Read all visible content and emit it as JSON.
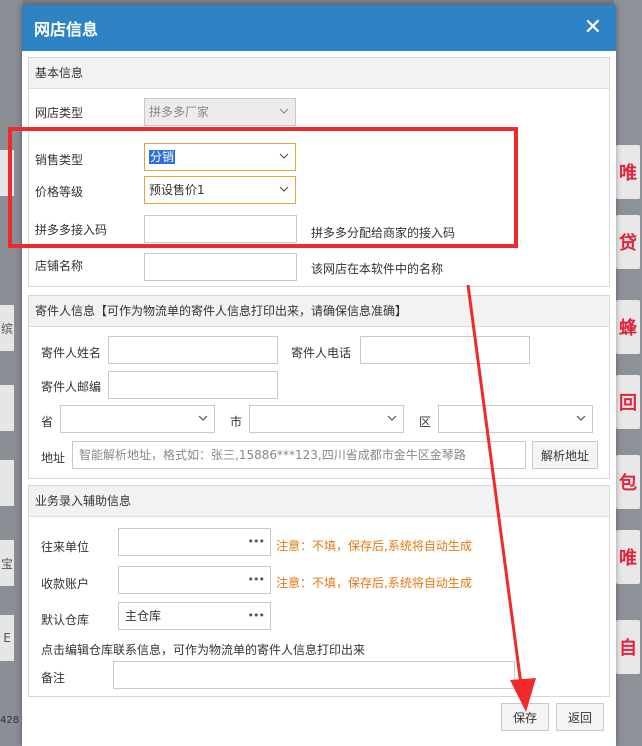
{
  "dialog": {
    "title": "网店信息",
    "close_glyph": "✕"
  },
  "basic": {
    "header": "基本信息",
    "shop_type_label": "网店类型",
    "shop_type_value": "拼多多厂家",
    "sales_type_label": "销售类型",
    "sales_type_value": "分销",
    "price_level_label": "价格等级",
    "price_level_value": "预设售价1",
    "access_code_label": "拼多多接入码",
    "access_code_hint": "拼多多分配给商家的接入码",
    "shop_name_label": "店铺名称",
    "shop_name_hint": "该网店在本软件中的名称"
  },
  "sender": {
    "header": "寄件人信息【可作为物流单的寄件人信息打印出来，请确保信息准确】",
    "name_label": "寄件人姓名",
    "phone_label": "寄件人电话",
    "postcode_label": "寄件人邮编",
    "province_label": "省",
    "city_label": "市",
    "district_label": "区",
    "address_label": "地址",
    "address_placeholder": "智能解析地址，格式如：张三,15886***123,四川省成都市金牛区金琴路",
    "parse_button": "解析地址"
  },
  "business": {
    "header": "业务录入辅助信息",
    "partner_label": "往来单位",
    "partner_note": "注意：不填，保存后,系统将自动生成",
    "account_label": "收款账户",
    "account_note": "注意：不填，保存后,系统将自动生成",
    "warehouse_label": "默认仓库",
    "warehouse_value": "主仓库",
    "warehouse_tip": "点击编辑仓库联系信息，可作为物流单的寄件人信息打印出来",
    "remark_label": "备注",
    "dots": "•••"
  },
  "footer": {
    "save_label": "保存",
    "back_label": "返回"
  },
  "background": {
    "tiles": [
      "唯",
      "贷",
      "蜂",
      "回",
      "包",
      "唯",
      "自"
    ],
    "left_tiles": [
      "",
      "缤",
      "",
      "",
      "宝",
      "E"
    ],
    "bottom_left_text": "428"
  },
  "colors": {
    "titlebar": "#2d83c4",
    "annotation_red": "#ee2a2a",
    "note_orange": "#e5780f"
  }
}
